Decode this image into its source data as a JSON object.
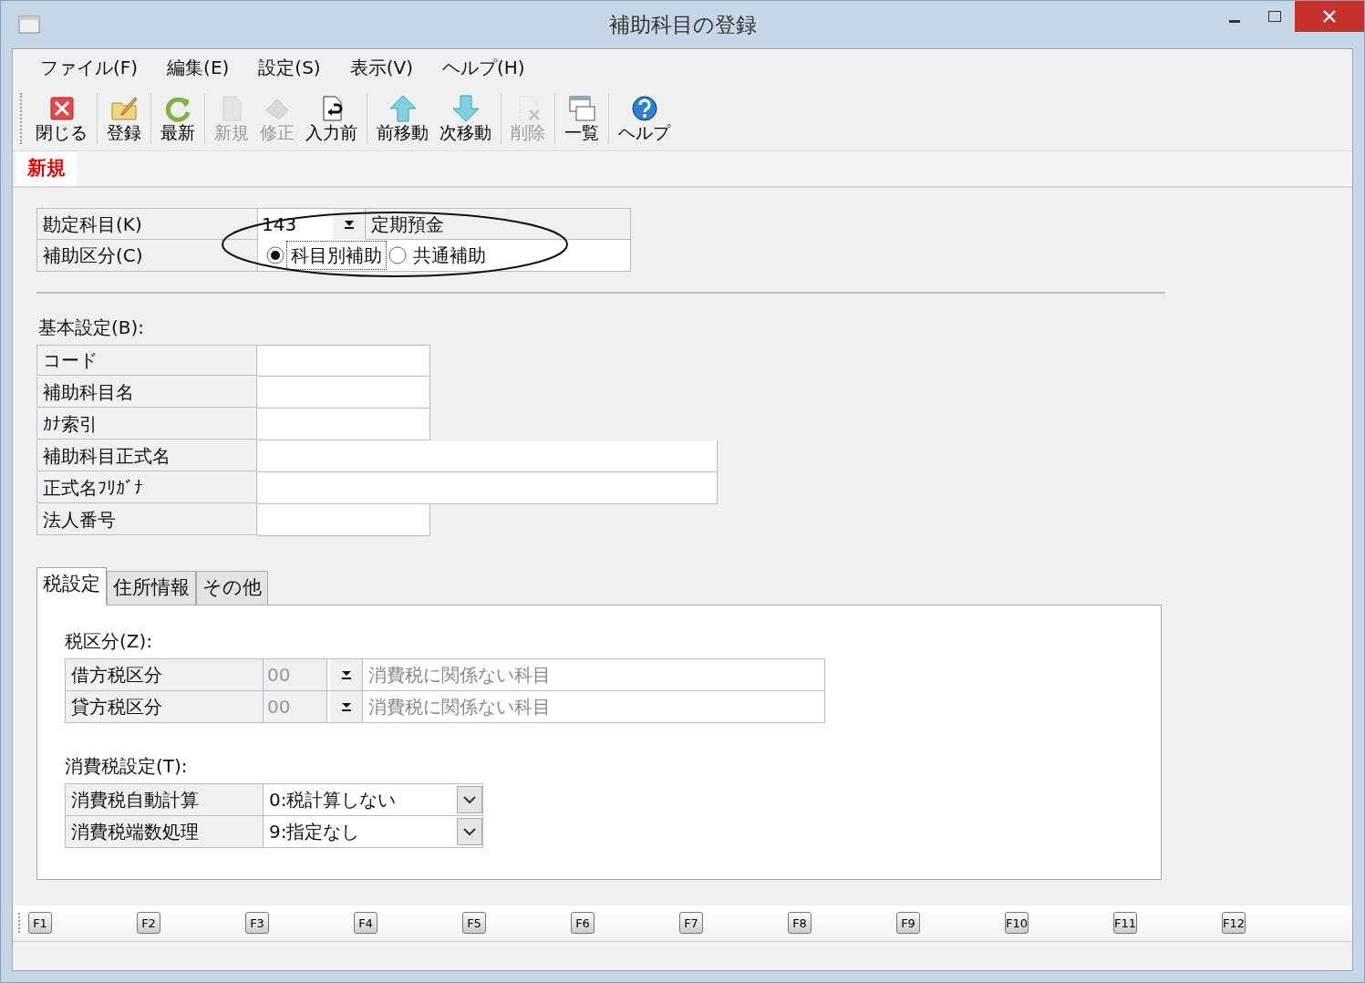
{
  "window": {
    "title": "補助科目の登録"
  },
  "menu": [
    "ファイル(F)",
    "編集(E)",
    "設定(S)",
    "表示(V)",
    "ヘルプ(H)"
  ],
  "toolbar": [
    {
      "label": "閉じる",
      "kind": "close",
      "disabled": false
    },
    {
      "label": "登録",
      "kind": "register",
      "disabled": false
    },
    {
      "label": "最新",
      "kind": "refresh",
      "disabled": false
    },
    {
      "label": "新規",
      "kind": "new",
      "disabled": true
    },
    {
      "label": "修正",
      "kind": "edit",
      "disabled": true
    },
    {
      "label": "入力前",
      "kind": "undo",
      "disabled": false
    },
    {
      "label": "前移動",
      "kind": "up",
      "disabled": false
    },
    {
      "label": "次移動",
      "kind": "down",
      "disabled": false
    },
    {
      "label": "削除",
      "kind": "delete",
      "disabled": true
    },
    {
      "label": "一覧",
      "kind": "list",
      "disabled": false
    },
    {
      "label": "ヘルプ",
      "kind": "help",
      "disabled": false
    }
  ],
  "mode": "新規",
  "account": {
    "label": "勘定科目(K)",
    "code": "143",
    "name": "定期預金"
  },
  "subsidiary_type": {
    "label": "補助区分(C)",
    "options": [
      {
        "label": "科目別補助",
        "selected": true
      },
      {
        "label": "共通補助",
        "selected": false
      }
    ]
  },
  "basic": {
    "heading": "基本設定(B):",
    "fields": [
      {
        "label": "コード",
        "kind": "short"
      },
      {
        "label": "補助科目名",
        "kind": "short"
      },
      {
        "label": "ｶﾅ索引",
        "kind": "short"
      },
      {
        "label": "補助科目正式名",
        "kind": "long"
      },
      {
        "label": "正式名ﾌﾘｶﾞﾅ",
        "kind": "long"
      },
      {
        "label": "法人番号",
        "kind": "short"
      }
    ]
  },
  "tabs": [
    {
      "label": "税設定",
      "selected": true
    },
    {
      "label": "住所情報",
      "selected": false
    },
    {
      "label": "その他",
      "selected": false
    }
  ],
  "tax": {
    "heading": "税区分(Z):",
    "rows": [
      {
        "label": "借方税区分",
        "code": "00",
        "name": "消費税に関係ない科目",
        "disabled": true
      },
      {
        "label": "貸方税区分",
        "code": "00",
        "name": "消費税に関係ない科目",
        "disabled": true
      }
    ]
  },
  "consumption": {
    "heading": "消費税設定(T):",
    "rows": [
      {
        "label": "消費税自動計算",
        "value": "0:税計算しない"
      },
      {
        "label": "消費税端数処理",
        "value": "9:指定なし"
      }
    ]
  },
  "function_keys": [
    "F1",
    "F2",
    "F3",
    "F4",
    "F5",
    "F6",
    "F7",
    "F8",
    "F9",
    "F10",
    "F11",
    "F12"
  ]
}
